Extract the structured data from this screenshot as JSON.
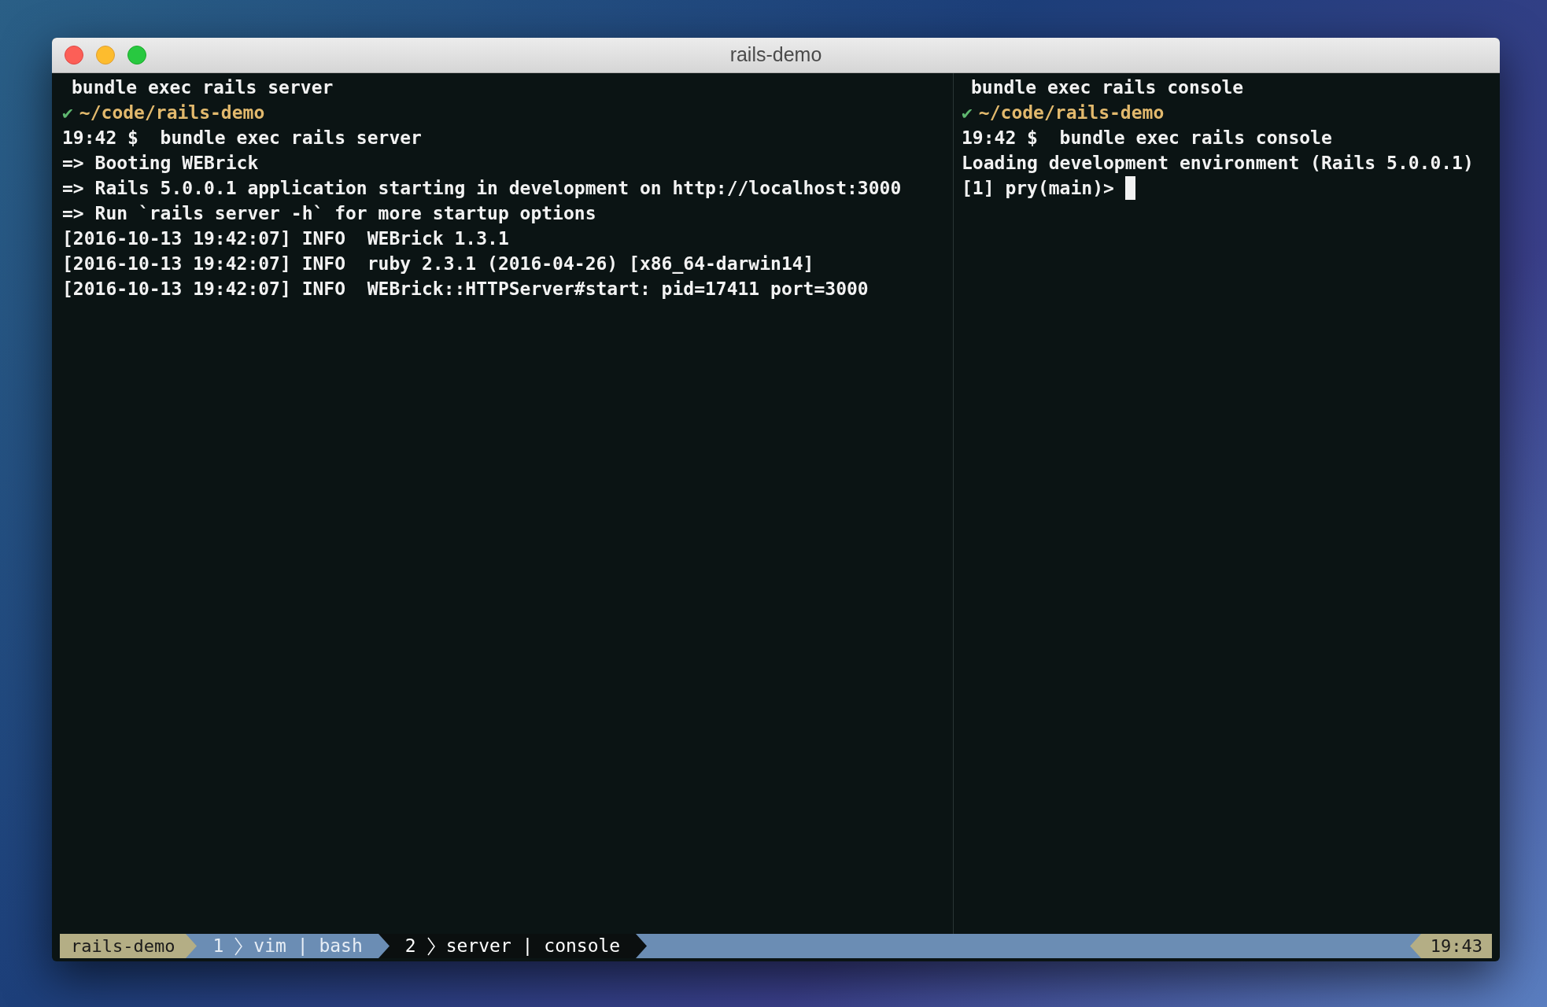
{
  "window": {
    "title": "rails-demo"
  },
  "panes": [
    {
      "title": "bundle exec rails server",
      "prompt_dir": "~/code/rails-demo",
      "prompt_mark": "✔",
      "cursor": false,
      "lines": [
        "19:42 $  bundle exec rails server",
        "=> Booting WEBrick",
        "=> Rails 5.0.0.1 application starting in development on http://localhost:3000",
        "=> Run `rails server -h` for more startup options",
        "[2016-10-13 19:42:07] INFO  WEBrick 1.3.1",
        "[2016-10-13 19:42:07] INFO  ruby 2.3.1 (2016-04-26) [x86_64-darwin14]",
        "[2016-10-13 19:42:07] INFO  WEBrick::HTTPServer#start: pid=17411 port=3000"
      ]
    },
    {
      "title": "bundle exec rails console",
      "prompt_dir": "~/code/rails-demo",
      "prompt_mark": "✔",
      "cursor": true,
      "lines": [
        "19:42 $  bundle exec rails console",
        "Loading development environment (Rails 5.0.0.1)",
        "[1] pry(main)> "
      ]
    }
  ],
  "status_bar": {
    "session": "rails-demo",
    "windows": [
      {
        "index": "1",
        "name": "vim | bash",
        "selected": false
      },
      {
        "index": "2",
        "name": "server | console",
        "selected": true
      }
    ],
    "clock": "19:43"
  }
}
